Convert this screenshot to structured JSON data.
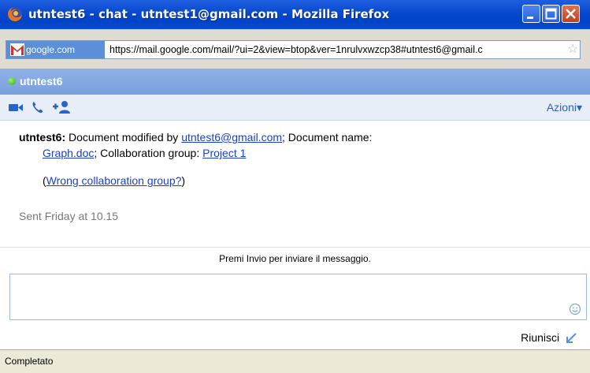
{
  "window": {
    "title": "utntest6 - chat - utntest1@gmail.com - Mozilla Firefox",
    "controls": [
      "minimize-icon",
      "maximize-icon",
      "close-icon"
    ]
  },
  "address_bar": {
    "site_label": "google.com",
    "url": "https://mail.google.com/mail/?ui=2&view=btop&ver=1nrulvxwzcp38#utntest6@gmail.c"
  },
  "chat": {
    "contact_name": "utntest6",
    "status_color": "#3cb417",
    "toolbar": {
      "icons": [
        "video-call-icon",
        "phone-call-icon",
        "add-person-icon"
      ],
      "actions_label": "Azioni",
      "actions_arrow": "▾"
    },
    "message": {
      "sender": "utntest6:",
      "text1": " Document modified by ",
      "link_email": "utntest6@gmail.com",
      "text2": "; Document name:",
      "link_doc": "Graph.doc",
      "text3": "; Collaboration group: ",
      "link_group": "Project 1",
      "wrong_open": "(",
      "wrong_link": "Wrong collaboration group?",
      "wrong_close": ")"
    },
    "timestamp": "Sent Friday at 10.15",
    "hint": "Premi Invio per inviare il messaggio.",
    "input_value": "",
    "popout_label": "Riunisci"
  },
  "status_bar": {
    "text": "Completato"
  },
  "colors": {
    "titlebar": "#0a4bd0",
    "chat_header": "#7a9fdd",
    "link": "#1a3fc9",
    "toolbar_icon": "#2a63c4"
  }
}
